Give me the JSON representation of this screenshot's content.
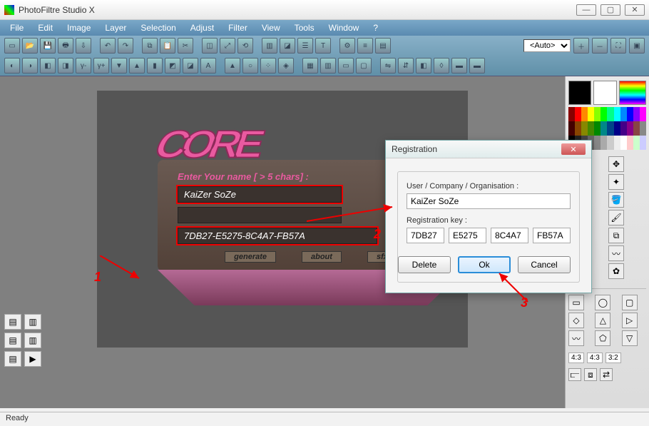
{
  "app": {
    "title": "PhotoFiltre Studio X"
  },
  "menu": [
    "File",
    "Edit",
    "Image",
    "Layer",
    "Selection",
    "Adjust",
    "Filter",
    "View",
    "Tools",
    "Window",
    "?"
  ],
  "zoom": {
    "value": "<Auto>"
  },
  "status": {
    "text": "Ready"
  },
  "keygen": {
    "logo": "CORE",
    "label": "Enter Your name [ > 5 chars] :",
    "name_value": "KaiZer SoZe",
    "serial_value": "7DB27-E5275-8C4A7-FB57A",
    "buttons": {
      "generate": "generate",
      "about": "about",
      "sfx": "sfx"
    }
  },
  "dialog": {
    "title": "Registration",
    "user_label": "User / Company / Organisation :",
    "user_value": "KaiZer SoZe",
    "key_label": "Registration key :",
    "key_parts": [
      "7DB27",
      "E5275",
      "8C4A7",
      "FB57A"
    ],
    "delete": "Delete",
    "ok": "Ok",
    "cancel": "Cancel"
  },
  "annotations": {
    "one": "1",
    "two": "2",
    "three": "3"
  },
  "ratios": {
    "a": "4:3",
    "b": "4:3",
    "c": "3:2"
  },
  "colors": {
    "fg": "#000000",
    "bg": "#ffffff"
  }
}
